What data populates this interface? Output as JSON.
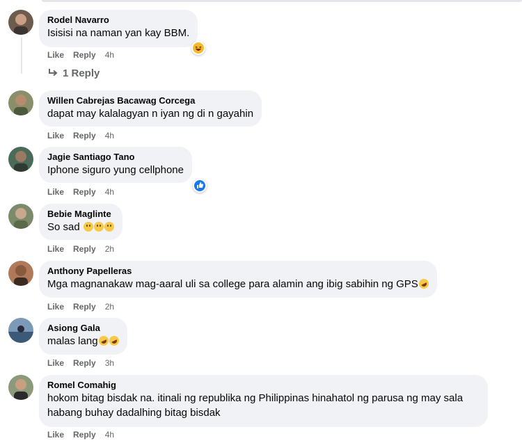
{
  "actions": {
    "like": "Like",
    "reply": "Reply"
  },
  "comments": [
    {
      "name": "Rodel Navarro",
      "text": "Isisisi na naman yan kay BBM.",
      "time": "4h",
      "reaction": "haha-icon"
    },
    {
      "name": "Willen Cabrejas Bacawag Corcega",
      "text": "dapat may kalalagyan n iyan ng di n gayahin",
      "time": "4h"
    },
    {
      "name": "Jagie Santiago Tano",
      "text": "Iphone siguro yung cellphone",
      "time": "4h",
      "reaction": "like-icon"
    },
    {
      "name": "Bebie Maglinte",
      "text": "So sad",
      "time": "2h",
      "emojis": [
        "sad-face-icon",
        "sad-face-icon",
        "sad-face-icon"
      ]
    },
    {
      "name": "Anthony Papelleras",
      "text": "Mga magnanakaw mag-aaral uli sa college para alamin ang ibig sabihin ng GPS",
      "time": "2h",
      "emojis": [
        "rofl-icon"
      ]
    },
    {
      "name": "Asiong Gala",
      "text": "malas lang",
      "time": "3h",
      "emojis": [
        "rofl-icon",
        "rofl-icon"
      ]
    },
    {
      "name": "Romel Comahig",
      "text": "hokom bitag bisdak na. itinali ng republika ng Philippinas hinahatol ng parusa ng may sala habang buhay dadalhing bitag bisdak",
      "time": "4h"
    }
  ],
  "replies_link": "1 Reply",
  "colors": {
    "bubble": "#f0f2f5",
    "meta": "#65676b",
    "like_blue": "#1877f2",
    "haha_yellow": "#f7b928"
  }
}
